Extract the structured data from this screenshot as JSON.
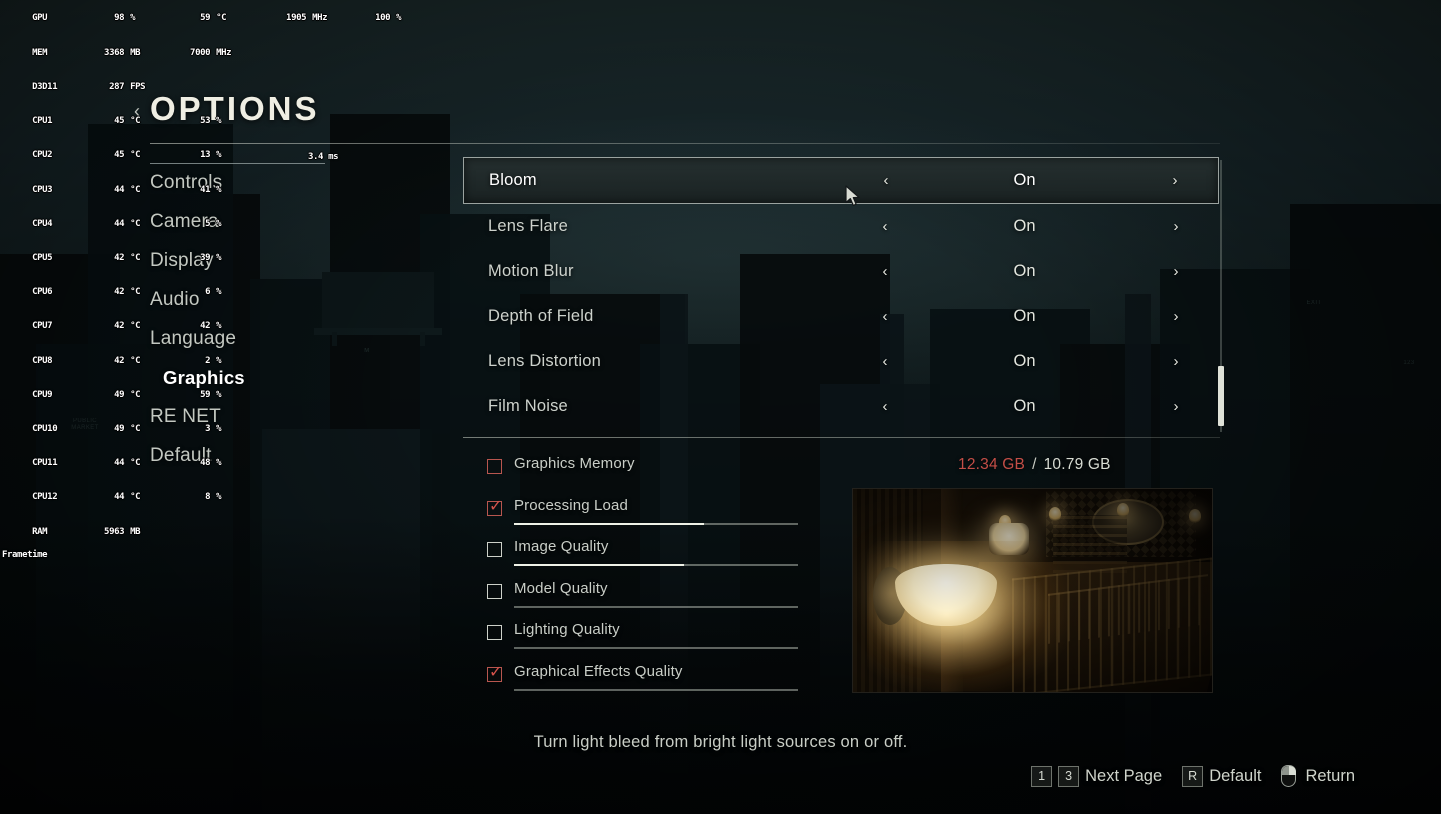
{
  "osd": {
    "rows": [
      {
        "label": "GPU",
        "value": "98",
        "unit": "%",
        "value2": "59",
        "unit2": "°C",
        "value3": "1905",
        "unit3": "MHz",
        "value4": "100",
        "unit4": "%"
      },
      {
        "label": "MEM",
        "value": "3368",
        "unit": "MB",
        "value2": "7000",
        "unit2": "MHz",
        "value3": "",
        "unit3": "",
        "value4": "",
        "unit4": ""
      },
      {
        "label": "D3D11",
        "value": "287",
        "unit": "FPS",
        "value2": "",
        "unit2": "",
        "value3": "",
        "unit3": "",
        "value4": "",
        "unit4": ""
      },
      {
        "label": "CPU1",
        "value": "45",
        "unit": "°C",
        "value2": "53",
        "unit2": "%",
        "value3": "",
        "unit3": "",
        "value4": "",
        "unit4": ""
      },
      {
        "label": "CPU2",
        "value": "45",
        "unit": "°C",
        "value2": "13",
        "unit2": "%",
        "value3": "",
        "unit3": "",
        "value4": "",
        "unit4": ""
      },
      {
        "label": "CPU3",
        "value": "44",
        "unit": "°C",
        "value2": "41",
        "unit2": "%",
        "value3": "",
        "unit3": "",
        "value4": "",
        "unit4": ""
      },
      {
        "label": "CPU4",
        "value": "44",
        "unit": "°C",
        "value2": "5",
        "unit2": "%",
        "value3": "",
        "unit3": "",
        "value4": "",
        "unit4": ""
      },
      {
        "label": "CPU5",
        "value": "42",
        "unit": "°C",
        "value2": "39",
        "unit2": "%",
        "value3": "",
        "unit3": "",
        "value4": "",
        "unit4": ""
      },
      {
        "label": "CPU6",
        "value": "42",
        "unit": "°C",
        "value2": "6",
        "unit2": "%",
        "value3": "",
        "unit3": "",
        "value4": "",
        "unit4": ""
      },
      {
        "label": "CPU7",
        "value": "42",
        "unit": "°C",
        "value2": "42",
        "unit2": "%",
        "value3": "",
        "unit3": "",
        "value4": "",
        "unit4": ""
      },
      {
        "label": "CPU8",
        "value": "42",
        "unit": "°C",
        "value2": "2",
        "unit2": "%",
        "value3": "",
        "unit3": "",
        "value4": "",
        "unit4": ""
      },
      {
        "label": "CPU9",
        "value": "49",
        "unit": "°C",
        "value2": "59",
        "unit2": "%",
        "value3": "",
        "unit3": "",
        "value4": "",
        "unit4": ""
      },
      {
        "label": "CPU10",
        "value": "49",
        "unit": "°C",
        "value2": "3",
        "unit2": "%",
        "value3": "",
        "unit3": "",
        "value4": "",
        "unit4": ""
      },
      {
        "label": "CPU11",
        "value": "44",
        "unit": "°C",
        "value2": "48",
        "unit2": "%",
        "value3": "",
        "unit3": "",
        "value4": "",
        "unit4": ""
      },
      {
        "label": "CPU12",
        "value": "44",
        "unit": "°C",
        "value2": "8",
        "unit2": "%",
        "value3": "",
        "unit3": "",
        "value4": "",
        "unit4": ""
      },
      {
        "label": "RAM",
        "value": "5963",
        "unit": "MB",
        "value2": "",
        "unit2": "",
        "value3": "",
        "unit3": "",
        "value4": "",
        "unit4": ""
      }
    ],
    "frametime_label": "Frametime",
    "frametime_value": "3.4 ms"
  },
  "header": {
    "back_icon": "‹",
    "title": "OPTIONS"
  },
  "nav": {
    "items": [
      {
        "label": "Controls",
        "selected": false
      },
      {
        "label": "Camera",
        "selected": false
      },
      {
        "label": "Display",
        "selected": false
      },
      {
        "label": "Audio",
        "selected": false
      },
      {
        "label": "Language",
        "selected": false
      },
      {
        "label": "Graphics",
        "selected": true
      },
      {
        "label": "RE NET",
        "selected": false
      },
      {
        "label": "Default",
        "selected": false
      }
    ]
  },
  "settings": {
    "left_arrow": "‹",
    "right_arrow": "›",
    "rows": [
      {
        "label": "Bloom",
        "value": "On",
        "highlight": true
      },
      {
        "label": "Lens Flare",
        "value": "On",
        "highlight": false
      },
      {
        "label": "Motion Blur",
        "value": "On",
        "highlight": false
      },
      {
        "label": "Depth of Field",
        "value": "On",
        "highlight": false
      },
      {
        "label": "Lens Distortion",
        "value": "On",
        "highlight": false
      },
      {
        "label": "Film Noise",
        "value": "On",
        "highlight": false
      }
    ]
  },
  "metrics": {
    "items": [
      {
        "label": "Graphics Memory",
        "checked": false,
        "red": true,
        "fill_percent": null
      },
      {
        "label": "Processing Load",
        "checked": true,
        "red": true,
        "fill_percent": 67
      },
      {
        "label": "Image Quality",
        "checked": false,
        "red": false,
        "fill_percent": 60
      },
      {
        "label": "Model Quality",
        "checked": false,
        "red": false,
        "fill_percent": 0
      },
      {
        "label": "Lighting Quality",
        "checked": false,
        "red": false,
        "fill_percent": 0
      },
      {
        "label": "Graphical Effects Quality",
        "checked": true,
        "red": true,
        "fill_percent": 0
      }
    ],
    "checkmark": "✓"
  },
  "memory": {
    "used": "12.34 GB",
    "separator": "/",
    "total": "10.79 GB",
    "used_color": "#c44e47"
  },
  "description": "Turn light bleed from bright light sources on or off.",
  "footer": {
    "prompts": [
      {
        "type": "keys",
        "keys": [
          "1",
          "3"
        ],
        "label": "Next Page"
      },
      {
        "type": "keys",
        "keys": [
          "R"
        ],
        "label": "Default"
      },
      {
        "type": "mouse",
        "keys": [],
        "label": "Return"
      }
    ]
  }
}
